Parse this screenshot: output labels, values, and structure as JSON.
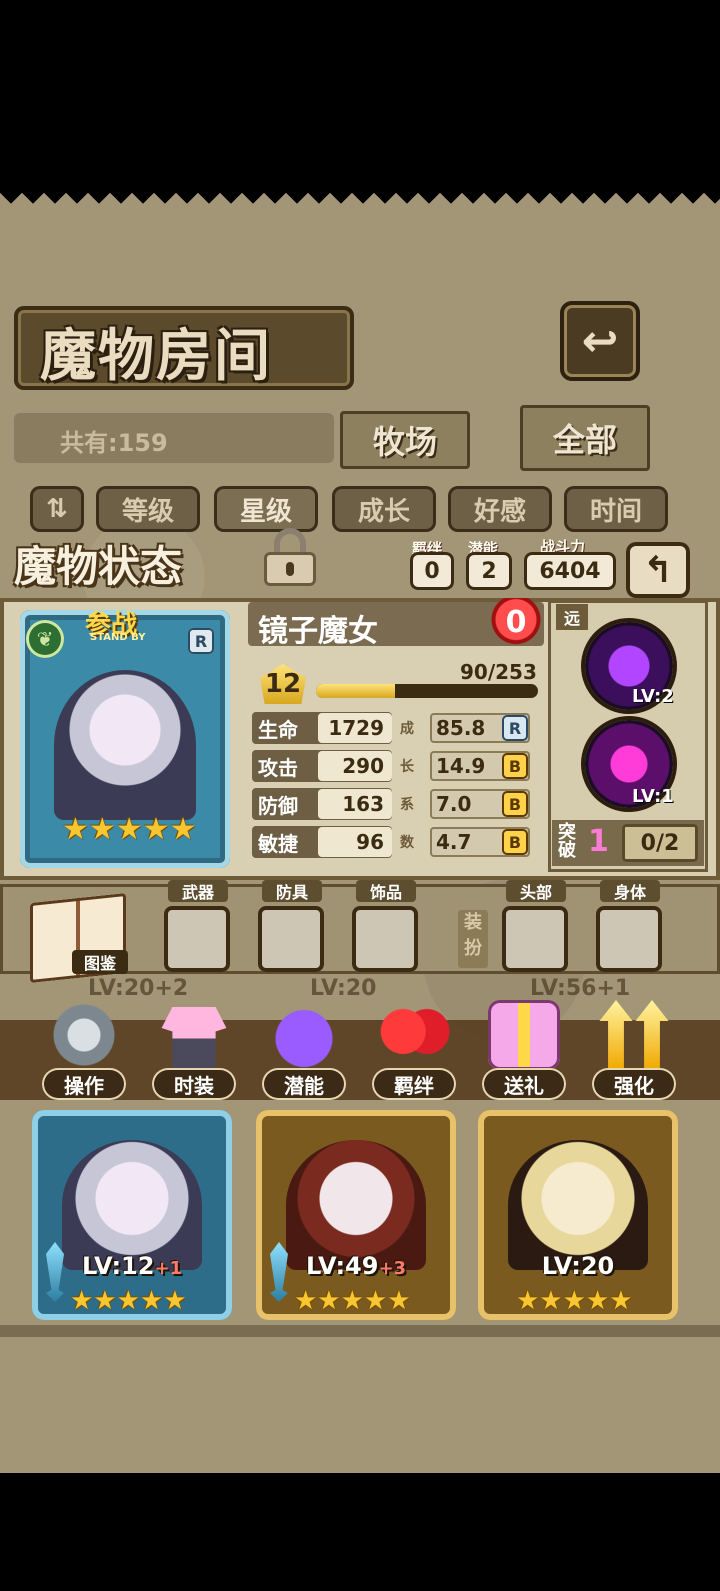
{
  "header": {
    "title": "魔物房间",
    "count_label": "共有:159",
    "tabs": [
      "牧场",
      "全部"
    ]
  },
  "sort": {
    "toggle_glyph": "⇅",
    "options": [
      "等级",
      "星级",
      "成长",
      "好感",
      "时间"
    ],
    "active": "星级"
  },
  "status": {
    "title": "魔物状态",
    "bond_label": "羁绊",
    "bond_value": "0",
    "potential_label": "潜能",
    "potential_value": "2",
    "power_label": "战斗力",
    "power_value": "6404"
  },
  "monster": {
    "name": "镜子魔女",
    "standby": "参战",
    "standby_sub": "STAND BY",
    "rank": "R",
    "affection": "0",
    "level": "12",
    "xp_text": "90/253",
    "xp_fraction": 0.356,
    "stars": "★★★★★",
    "stats": [
      {
        "label": "生命",
        "value": "1729",
        "growth": "85.8",
        "grade": "R"
      },
      {
        "label": "攻击",
        "value": "290",
        "growth": "14.9",
        "grade": "B"
      },
      {
        "label": "防御",
        "value": "163",
        "growth": "7.0",
        "grade": "B"
      },
      {
        "label": "敏捷",
        "value": "96",
        "growth": "4.7",
        "grade": "B"
      }
    ],
    "growth_vertical": [
      "成",
      "长",
      "系",
      "数"
    ],
    "range": "远",
    "skills": [
      {
        "level": "LV:2"
      },
      {
        "level": "LV:1"
      }
    ],
    "breakthrough_label": "突破",
    "breakthrough_value": "1",
    "breakthrough_progress": "0/2"
  },
  "equipment": {
    "book_label": "图鉴",
    "slots": [
      "武器",
      "防具",
      "饰品",
      "头部",
      "身体"
    ],
    "outfit_label": "装扮"
  },
  "actions": [
    {
      "label": "操作",
      "icon": "gear-icon"
    },
    {
      "label": "时装",
      "icon": "outfit-icon"
    },
    {
      "label": "潜能",
      "icon": "demon-icon"
    },
    {
      "label": "羁绊",
      "icon": "hearts-icon"
    },
    {
      "label": "送礼",
      "icon": "gift-icon"
    },
    {
      "label": "强化",
      "icon": "arrow-up-icon"
    }
  ],
  "roster_top_levels": [
    "LV:20",
    "+2",
    "LV:20",
    "LV:56",
    "+1"
  ],
  "roster": [
    {
      "level": "LV:12",
      "plus": "+1",
      "stars": "★★★★★"
    },
    {
      "level": "LV:49",
      "plus": "+3",
      "stars": "★★★★★"
    },
    {
      "level": "LV:20",
      "plus": "",
      "stars": "★★★★★"
    }
  ],
  "colors": {
    "accent_gold": "#ffd84a",
    "rank_blue": "#2b4a66",
    "bond_pink": "#ff7ad7",
    "heart_red": "#e0242a"
  }
}
